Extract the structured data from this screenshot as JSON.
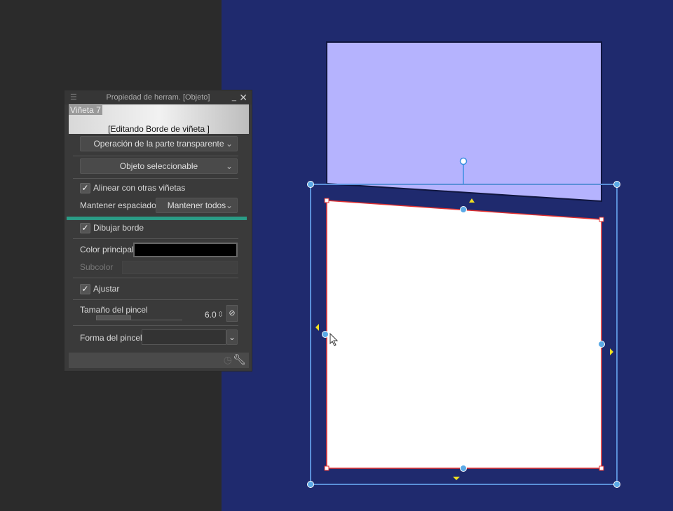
{
  "panel": {
    "title": "Propiedad de herram. [Objeto]",
    "menu_icon": "hamburger-icon",
    "minimize_icon": "minimize-icon",
    "close_icon": "close-icon",
    "preview_name": "Viñeta 7",
    "preview_status": "[Editando Borde de viñeta ]",
    "transparent_op": "Operación de la parte transparente",
    "selectable": "Objeto seleccionable",
    "align_label": "Alinear con otras viñetas",
    "align_checked": true,
    "spacing_label": "Mantener espaciado",
    "spacing_value": "Mantener todos",
    "draw_border_label": "Dibujar borde",
    "draw_border_checked": true,
    "main_color_label": "Color principal",
    "main_color": "#000000",
    "subcolor_label": "Subcolor",
    "adjust_label": "Ajustar",
    "adjust_checked": true,
    "brush_size_label": "Tamaño del pincel",
    "brush_size_value": "6.0",
    "brush_shape_label": "Forma del pincel",
    "brush_shape_value": "",
    "check_glyph": "✓",
    "chevron": "⌵",
    "spin": "⇳",
    "pressure_glyph": "⊘"
  },
  "colors": {
    "canvas_bg": "#1f2a6e",
    "panel_upper": "#b5b3fe",
    "panel_lower": "#ffffff",
    "selection": "#3b8fe0",
    "accent": "#2a9c86"
  }
}
